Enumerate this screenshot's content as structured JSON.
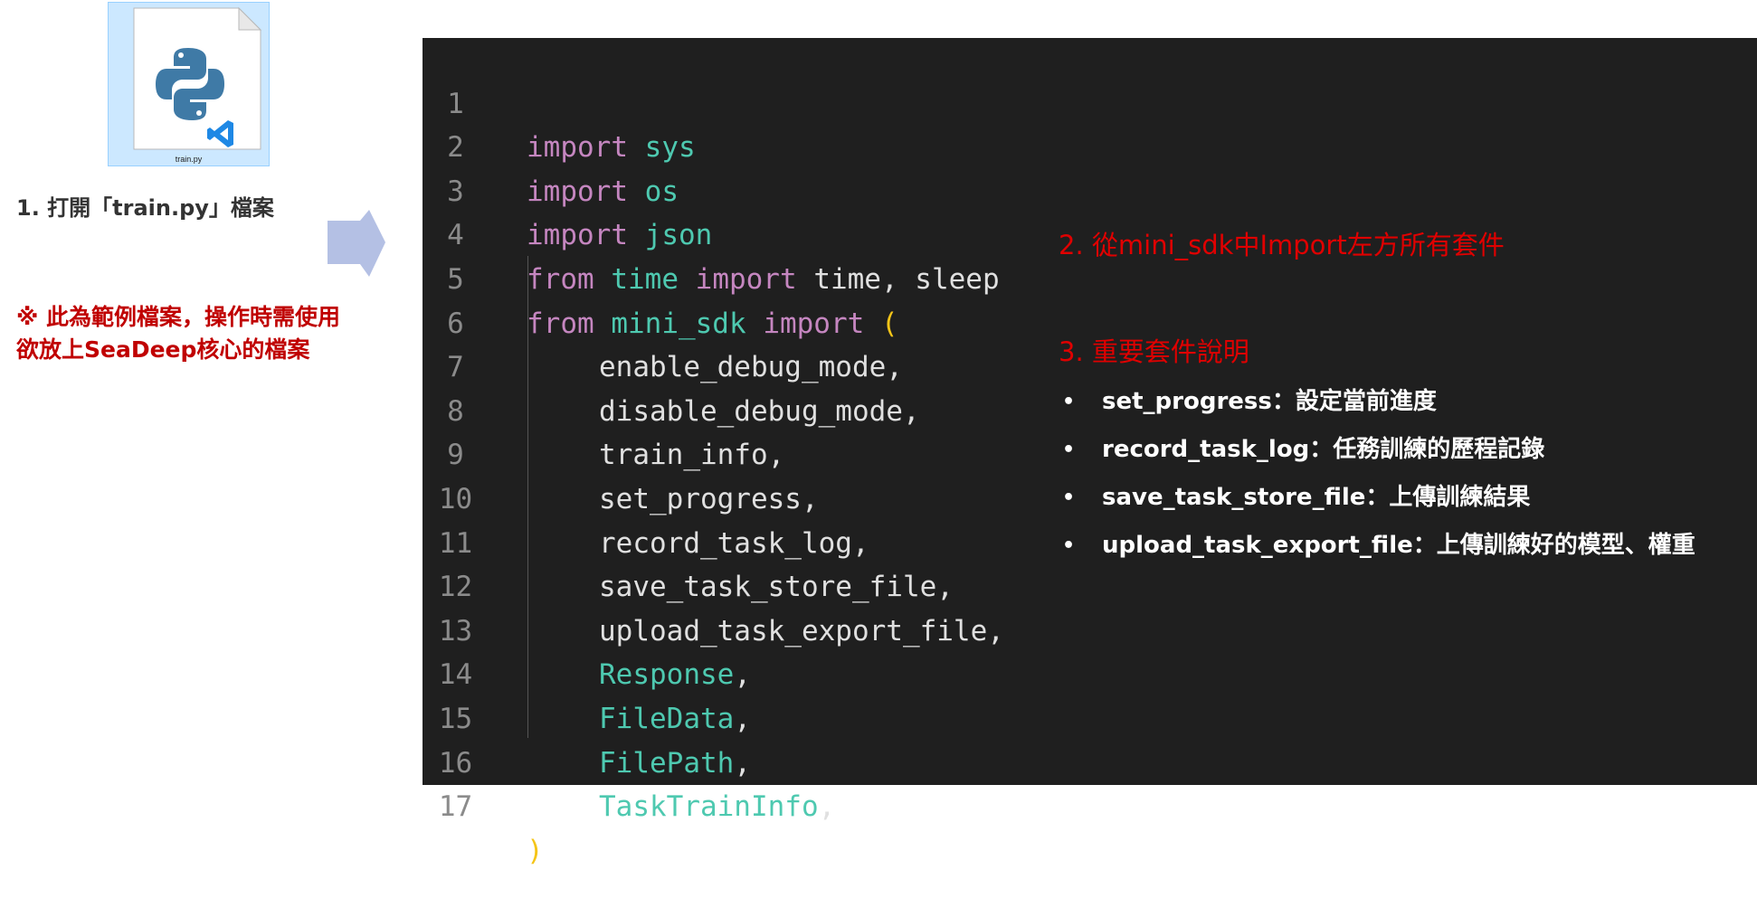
{
  "file_icon": {
    "label": "train.py",
    "icon": "python-file-icon",
    "badge_icon": "vscode-icon",
    "tile_color": "#cce8ff"
  },
  "steps": {
    "step1": "1. 打開「train.py」檔案",
    "note_line1": "※ 此為範例檔案，操作時需使用",
    "note_line2": "欲放上SeaDeep核心的檔案",
    "step2": "2. 從mini_sdk中Import左方所有套件",
    "step3": "3. 重要套件說明"
  },
  "code_lines": [
    {
      "n": "1"
    },
    {
      "n": "2"
    },
    {
      "n": "3"
    },
    {
      "n": "4"
    },
    {
      "n": "5"
    },
    {
      "n": "6"
    },
    {
      "n": "7"
    },
    {
      "n": "8"
    },
    {
      "n": "9"
    },
    {
      "n": "10"
    },
    {
      "n": "11"
    },
    {
      "n": "12"
    },
    {
      "n": "13"
    },
    {
      "n": "14"
    },
    {
      "n": "15"
    },
    {
      "n": "16"
    },
    {
      "n": "17"
    }
  ],
  "code": {
    "l1_kw": "import",
    "l1_mod": "sys",
    "l2_kw": "import",
    "l2_mod": "os",
    "l3_kw": "import",
    "l3_mod": "json",
    "l4_from": "from",
    "l4_mod": "time",
    "l4_import": "import",
    "l4_rest": "time, sleep",
    "l5_from": "from",
    "l5_mod": "mini_sdk",
    "l5_import": "import",
    "l5_paren": "(",
    "l6": "enable_debug_mode,",
    "l7": "disable_debug_mode,",
    "l8": "train_info,",
    "l9": "set_progress,",
    "l10": "record_task_log,",
    "l11": "save_task_store_file,",
    "l12": "upload_task_export_file,",
    "l13": "Response",
    "l14": "FileData",
    "l15": "FilePath",
    "l16": "TaskTrainInfo",
    "comma": ",",
    "l17": ")"
  },
  "bullets": [
    {
      "dot": "•",
      "text": "set_progress：設定當前進度"
    },
    {
      "dot": "•",
      "text": "record_task_log：任務訓練的歷程記錄"
    },
    {
      "dot": "•",
      "text": "save_task_store_file：上傳訓練結果"
    },
    {
      "dot": "•",
      "text": "upload_task_export_file：上傳訓練好的模型、權重"
    }
  ],
  "colors": {
    "editor_bg": "#1f1f1f",
    "keyword": "#c586c0",
    "module": "#4ec9b0",
    "annotation_red": "#e00000",
    "arrow": "#b4c0e4"
  }
}
